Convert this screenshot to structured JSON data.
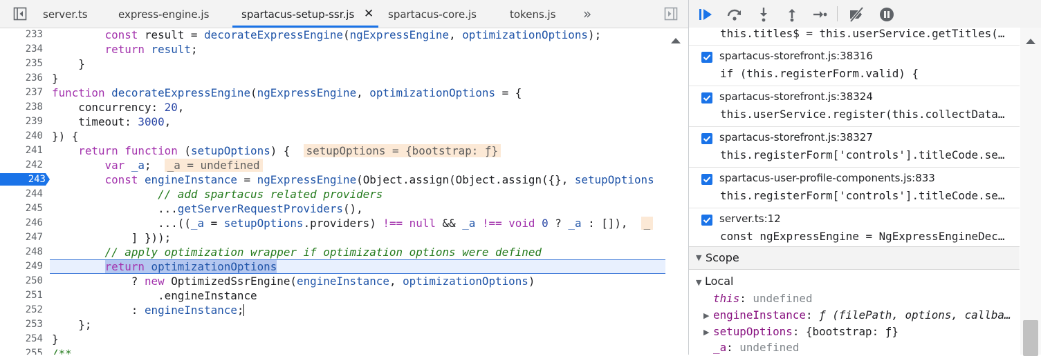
{
  "editor": {
    "tabs": [
      {
        "label": "server.ts"
      },
      {
        "label": "express-engine.js"
      },
      {
        "label": "spartacus-setup-ssr.js"
      },
      {
        "label": "spartacus-core.js"
      },
      {
        "label": "tokens.js"
      }
    ],
    "close_glyph": "✕",
    "more_tabs_glyph": "»",
    "breakpoint_line": "243",
    "paused_line": "249",
    "line_numbers": [
      "233",
      "234",
      "235",
      "236",
      "237",
      "238",
      "239",
      "240",
      "241",
      "242",
      "243",
      "244",
      "245",
      "246",
      "247",
      "248",
      "249",
      "250",
      "251",
      "252",
      "253",
      "254",
      "255"
    ],
    "lines": {
      "l233": [
        "        ",
        "const",
        " result = ",
        "decorateExpressEngine",
        "(",
        "ngExpressEngine",
        ", ",
        "optimizationOptions",
        ");"
      ],
      "l234": [
        "        ",
        "return",
        " ",
        "result",
        ";"
      ],
      "l235": "    }",
      "l236": "}",
      "l237": [
        "function",
        " ",
        "decorateExpressEngine",
        "(",
        "ngExpressEngine",
        ", ",
        "optimizationOptions",
        " = {"
      ],
      "l238": [
        "    concurrency: ",
        "20",
        ","
      ],
      "l239": [
        "    timeout: ",
        "3000",
        ","
      ],
      "l240": "}) {",
      "l241": [
        "    ",
        "return",
        " ",
        "function",
        " (",
        "setupOptions",
        ") {  ",
        "setupOptions = {bootstrap: ƒ}"
      ],
      "l242": [
        "        ",
        "var",
        " ",
        "_a",
        ";  ",
        "_a = undefined"
      ],
      "l243": [
        "        ",
        "const",
        " ",
        "engineInstance",
        " = ",
        "ngExpressEngine",
        "(Object.assign(Object.assign({}, ",
        "setupOptions"
      ],
      "l244": [
        "                ",
        "// add spartacus related providers"
      ],
      "l245": [
        "                ...",
        "getServerRequestProviders",
        "(),"
      ],
      "l246": [
        "                ...((",
        "_a",
        " = ",
        "setupOptions",
        ".providers) ",
        "!==",
        " ",
        "null",
        " && ",
        "_a",
        " ",
        "!==",
        " ",
        "void",
        " ",
        "0",
        " ? ",
        "_a",
        " : []),  ",
        "_"
      ],
      "l247": "            ] }));",
      "l248": [
        "        ",
        "// apply optimization wrapper if optimization options were defined"
      ],
      "l249": [
        "        ",
        "return",
        " ",
        "optimizationOptions"
      ],
      "l250": [
        "            ? ",
        "new",
        " OptimizedSsrEngine(",
        "engineInstance",
        ", ",
        "optimizationOptions",
        ")"
      ],
      "l251": "                .engineInstance",
      "l252": [
        "            : ",
        "engineInstance",
        ";"
      ],
      "l253": "    };",
      "l254": "}",
      "l255": "/**"
    }
  },
  "debugger": {
    "toolbar": [
      {
        "icon": "resume-icon"
      },
      {
        "icon": "step-over-icon"
      },
      {
        "icon": "step-into-icon"
      },
      {
        "icon": "step-out-icon"
      },
      {
        "icon": "step-icon"
      },
      {
        "icon": "deactivate-breakpoints-icon"
      },
      {
        "icon": "pause-on-exceptions-icon"
      }
    ],
    "first_breakpoint_code": "this.titles$ = this.userService.getTitles(…",
    "breakpoints": [
      {
        "location": "spartacus-storefront.js:38316",
        "code": "if (this.registerForm.valid) {",
        "checked": true
      },
      {
        "location": "spartacus-storefront.js:38324",
        "code": "this.userService.register(this.collectData…",
        "checked": true
      },
      {
        "location": "spartacus-storefront.js:38327",
        "code": "this.registerForm['controls'].titleCode.se…",
        "checked": true
      },
      {
        "location": "spartacus-user-profile-components.js:833",
        "code": "this.registerForm['controls'].titleCode.se…",
        "checked": true
      },
      {
        "location": "server.ts:12",
        "code": "const ngExpressEngine = NgExpressEngineDec…",
        "checked": true
      }
    ],
    "scope": {
      "title": "Scope",
      "local_title": "Local",
      "this_key": "this",
      "this_value": "undefined",
      "engine_key": "engineInstance",
      "engine_value": "ƒ (filePath, options, callba…",
      "setup_key": "setupOptions",
      "setup_value": "{bootstrap: ƒ}",
      "a_key": "_a",
      "a_value": "undefined"
    }
  },
  "colors": {
    "accent": "#1a73e8",
    "keyword": "#a333ad",
    "comment": "#237a1c",
    "inline_value_bg": "#fce9d6",
    "paused_line_bg": "#e8f0fe"
  }
}
